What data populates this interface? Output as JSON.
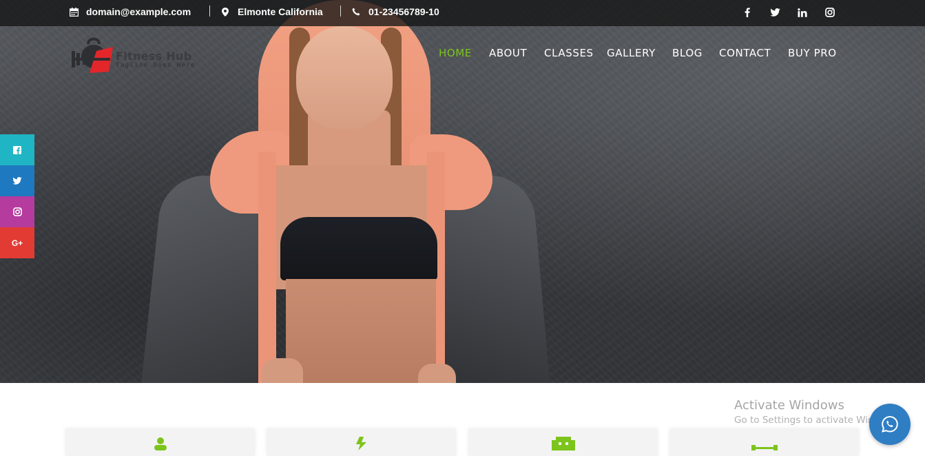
{
  "topbar": {
    "email": "domain@example.com",
    "location": "Elmonte California",
    "phone": "01-23456789-10",
    "social": [
      "facebook-icon",
      "twitter-icon",
      "linkedin-icon",
      "instagram-icon"
    ]
  },
  "logo": {
    "title": "Fitness Hub",
    "tagline": "Tagline Goes Here"
  },
  "nav": {
    "items": [
      "HOME",
      "ABOUT",
      "CLASSES",
      "GALLERY",
      "BLOG",
      "CONTACT",
      "BUY PRO"
    ],
    "active": "HOME"
  },
  "side_social": [
    "facebook-icon",
    "twitter-icon",
    "instagram-icon",
    "google-plus-icon"
  ],
  "side_social_labels": {
    "google_plus": "G+"
  },
  "watermark": {
    "line1": "Activate Windows",
    "line2": "Go to Settings to activate Windows."
  },
  "colors": {
    "accent": "#7cc41b",
    "facebook": "#1fb5c4",
    "twitter": "#1f79c0",
    "instagram": "#b53b9e",
    "google_plus": "#e23b34",
    "chat": "#2f7ec4",
    "logo_red": "#e3262a"
  },
  "chat_button": "whatsapp-icon"
}
